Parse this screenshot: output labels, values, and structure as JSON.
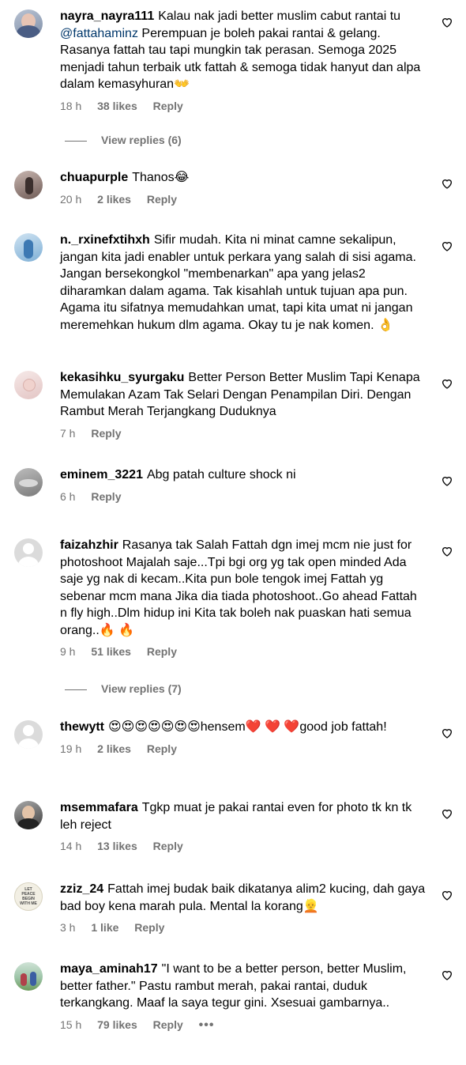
{
  "comments": [
    {
      "user": "nayra_nayra111",
      "pre": "Kalau nak jadi better muslim cabut rantai tu ",
      "mention": "@fattahaminz",
      "text": " Perempuan je boleh pakai rantai & gelang. Rasanya fattah tau tapi mungkin tak perasan. Semoga 2025 menjadi tahun terbaik utk fattah & semoga tidak hanyut dan alpa dalam kemasyhuran👐",
      "time": "18 h",
      "likes": "38 likes",
      "reply": "Reply",
      "view_replies": "View replies (6)"
    },
    {
      "user": "chuapurple",
      "text": "Thanos😂",
      "time": "20 h",
      "likes": "2 likes",
      "reply": "Reply"
    },
    {
      "user": "n._rxinefxtihxh",
      "text": "Sifir mudah. Kita ni minat camne sekalipun, jangan kita jadi enabler untuk perkara yang salah di sisi agama. Jangan bersekongkol \"membenarkan\" apa yang jelas2 diharamkan dalam agama. Tak kisahlah untuk tujuan apa pun. Agama itu sifatnya memudahkan umat, tapi kita umat ni jangan meremehkan hukum dlm agama. Okay tu je nak komen. 👌",
      "time": "",
      "likes": "",
      "reply": ""
    },
    {
      "user": "kekasihku_syurgaku",
      "text": "Better Person Better Muslim Tapi Kenapa Memulakan Azam Tak Selari Dengan Penampilan Diri. Dengan Rambut Merah Terjangkang Duduknya",
      "time": "7 h",
      "likes": "",
      "reply": "Reply"
    },
    {
      "user": "eminem_3221",
      "text": "Abg patah culture shock ni",
      "time": "6 h",
      "likes": "",
      "reply": "Reply"
    },
    {
      "user": "faizahzhir",
      "text": "Rasanya tak Salah Fattah dgn imej mcm nie just for photoshoot Majalah saje...Tpi bgi org yg tak open minded Ada saje yg nak di kecam..Kita pun bole tengok imej Fattah yg sebenar mcm mana Jika dia tiada photoshoot..Go ahead Fattah n fly high..Dlm hidup ini Kita tak boleh nak puaskan hati semua orang..🔥 🔥",
      "time": "9 h",
      "likes": "51 likes",
      "reply": "Reply",
      "view_replies": "View replies (7)"
    },
    {
      "user": "thewytt",
      "text": "😍😍😍😍😍😍😍hensem❤️ ❤️ ❤️good job fattah!",
      "time": "19 h",
      "likes": "2 likes",
      "reply": "Reply"
    },
    {
      "user": "msemmafara",
      "text": "Tgkp muat je pakai rantai even for photo tk kn tk leh reject",
      "time": "14 h",
      "likes": "13 likes",
      "reply": "Reply"
    },
    {
      "user": "zziz_24",
      "text": "Fattah imej budak baik dikatanya alim2 kucing, dah gaya bad boy kena marah pula. Mental la korang👱",
      "time": "3 h",
      "likes": "1 like",
      "reply": "Reply",
      "avatar_text": "LET PEACE BEGIN WITH ME"
    },
    {
      "user": "maya_aminah17",
      "text": "\"I want to be a better person, better Muslim, better father.\" Pastu rambut merah, pakai rantai, duduk terkangkang. Maaf la saya tegur gini. Xsesuai gambarnya..",
      "time": "15 h",
      "likes": "79 likes",
      "reply": "Reply",
      "more": "•••"
    }
  ],
  "colors": {
    "text": "#000000",
    "secondary": "#737373",
    "mention": "#00376b",
    "background": "#ffffff"
  },
  "icons": [
    "heart-outline-icon",
    "default-avatar-icon",
    "more-options-icon"
  ]
}
